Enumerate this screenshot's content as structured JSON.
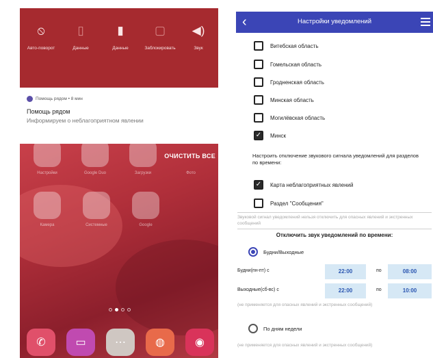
{
  "left_phone": {
    "quick_settings": [
      {
        "icon": "autorotate-off-icon",
        "label": "Авто-поворот"
      },
      {
        "icon": "data-icon",
        "label": "Данные"
      },
      {
        "icon": "sim-data-icon",
        "label": "Данные"
      },
      {
        "icon": "lock-screen-icon",
        "label": "Заблокировать"
      },
      {
        "icon": "sound-icon",
        "label": "Звук"
      }
    ],
    "notification": {
      "app_line": "Помощь рядом • 8 мин",
      "title": "Помощь рядом",
      "text": "Информируем о неблагоприятном явлении"
    },
    "clear_all": "ОЧИСТИТЬ ВСЕ",
    "home_icon_labels": [
      "Настройки",
      "Google Duo",
      "Загрузки",
      "Фото",
      "Камера",
      "Системные",
      "Google"
    ],
    "dock_icons": [
      "phone-icon",
      "messages-icon",
      "apps-icon",
      "browser-icon",
      "camera-icon"
    ],
    "colors": {
      "quick_settings_bg": "#a62a2f",
      "accent": "#5b4fa8"
    }
  },
  "right_phone": {
    "title": "Настройки уведомлений",
    "regions": [
      {
        "label": "Витебская область",
        "checked": false
      },
      {
        "label": "Гомельская область",
        "checked": false
      },
      {
        "label": "Гродненская область",
        "checked": false
      },
      {
        "label": "Минская область",
        "checked": false
      },
      {
        "label": "Могилёвская область",
        "checked": false
      },
      {
        "label": "Минск",
        "checked": true
      }
    ],
    "sound_section_text": "Настроить отключение звукового сигнала уведомлений для разделов по времени:",
    "sections": [
      {
        "label": "Карта неблагоприятных явлений",
        "checked": true
      },
      {
        "label": "Раздел \"Сообщения\"",
        "checked": false
      }
    ],
    "warning_note": "Звуковой сигнал уведомлений нельзя отключить для опасных явлений и экстренных сообщений",
    "disable_by_time_title": "Отключить звук уведомлений по времени:",
    "mode_weekdays": "Будни/Выходные",
    "weekday_row": {
      "label": "Будни(пн-пт) с",
      "from": "22:00",
      "to_word": "по",
      "to": "08:00"
    },
    "weekend_row": {
      "label": "Выходные(сб-вс) с",
      "from": "22:00",
      "to_word": "по",
      "to": "10:00"
    },
    "note_1": "(не применяется для опасных явлений и экстренных сообщений)",
    "mode_days": "По дням недели",
    "note_2": "(не применяется для опасных явлений и экстренных сообщений)",
    "colors": {
      "app_bar": "#3b45b6",
      "time_box_bg": "#d6e8f5",
      "time_text": "#2a55b0"
    }
  }
}
